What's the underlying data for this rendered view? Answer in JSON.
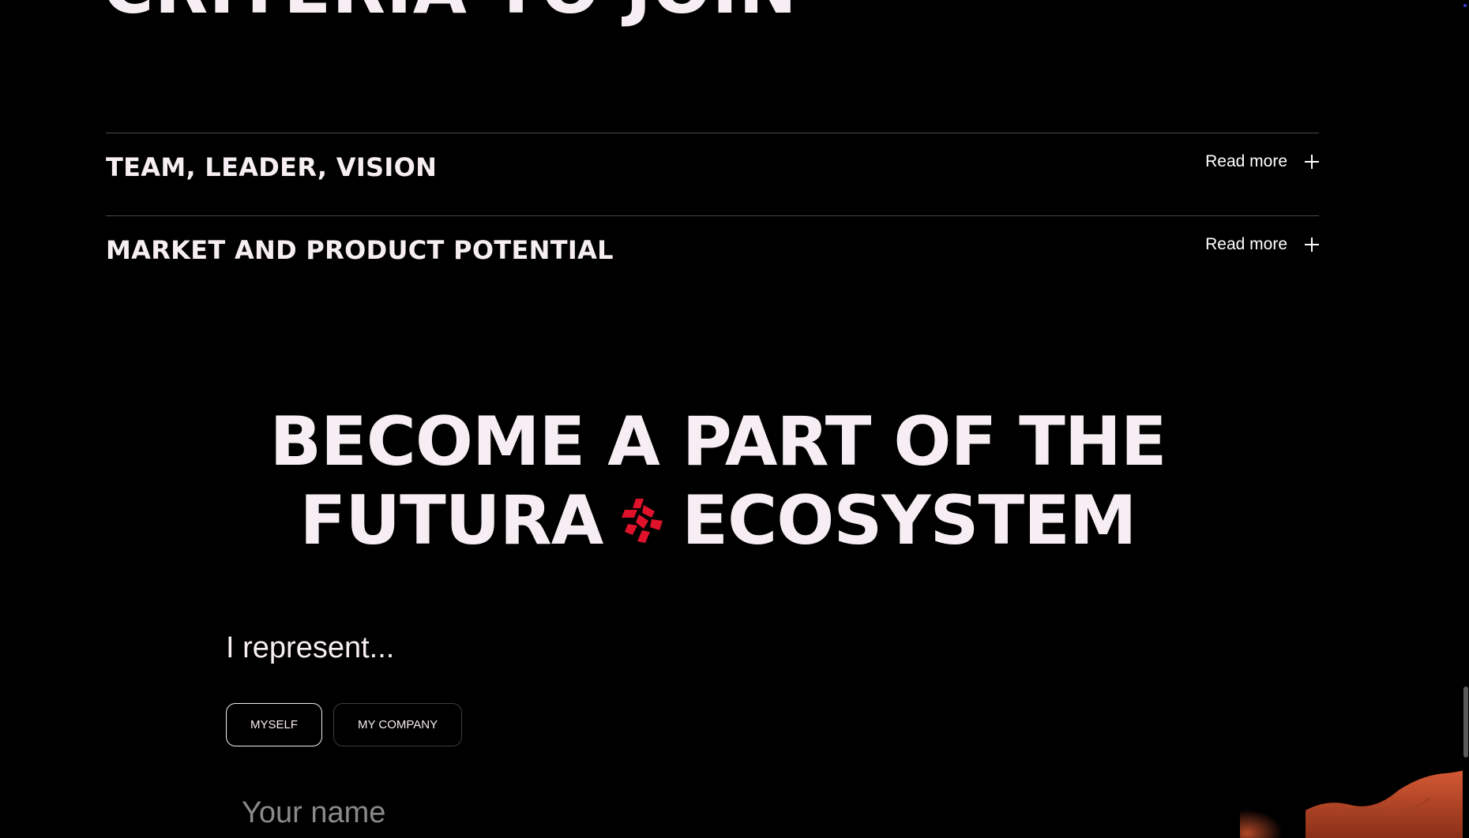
{
  "criteria": {
    "heading": "CRITERIA TO JOIN",
    "items": [
      {
        "title": "TEAM, LEADER, VISION",
        "action_label": "Read more"
      },
      {
        "title": "MARKET AND PRODUCT POTENTIAL",
        "action_label": "Read more"
      }
    ]
  },
  "cta": {
    "line1": "BECOME A PART OF THE",
    "line2_left": "FUTURA",
    "line2_right": "ECOSYSTEM",
    "logo_icon": "futura-logo-icon"
  },
  "form": {
    "represent_label": "I represent...",
    "options": [
      {
        "label": "MYSELF",
        "selected": true
      },
      {
        "label": "MY COMPANY",
        "selected": false
      }
    ],
    "name_placeholder": "Your name"
  },
  "colors": {
    "background": "#000000",
    "text": "#f6eef2",
    "accent_red": "#e0122b",
    "terrain": "#c4502c"
  }
}
